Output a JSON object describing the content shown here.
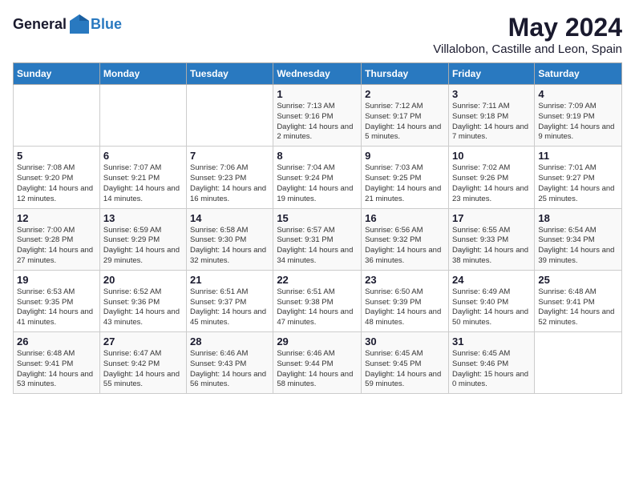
{
  "header": {
    "logo_general": "General",
    "logo_blue": "Blue",
    "month_year": "May 2024",
    "location": "Villalobon, Castille and Leon, Spain"
  },
  "calendar": {
    "weekdays": [
      "Sunday",
      "Monday",
      "Tuesday",
      "Wednesday",
      "Thursday",
      "Friday",
      "Saturday"
    ],
    "weeks": [
      [
        {
          "day": "",
          "info": ""
        },
        {
          "day": "",
          "info": ""
        },
        {
          "day": "",
          "info": ""
        },
        {
          "day": "1",
          "info": "Sunrise: 7:13 AM\nSunset: 9:16 PM\nDaylight: 14 hours\nand 2 minutes."
        },
        {
          "day": "2",
          "info": "Sunrise: 7:12 AM\nSunset: 9:17 PM\nDaylight: 14 hours\nand 5 minutes."
        },
        {
          "day": "3",
          "info": "Sunrise: 7:11 AM\nSunset: 9:18 PM\nDaylight: 14 hours\nand 7 minutes."
        },
        {
          "day": "4",
          "info": "Sunrise: 7:09 AM\nSunset: 9:19 PM\nDaylight: 14 hours\nand 9 minutes."
        }
      ],
      [
        {
          "day": "5",
          "info": "Sunrise: 7:08 AM\nSunset: 9:20 PM\nDaylight: 14 hours\nand 12 minutes."
        },
        {
          "day": "6",
          "info": "Sunrise: 7:07 AM\nSunset: 9:21 PM\nDaylight: 14 hours\nand 14 minutes."
        },
        {
          "day": "7",
          "info": "Sunrise: 7:06 AM\nSunset: 9:23 PM\nDaylight: 14 hours\nand 16 minutes."
        },
        {
          "day": "8",
          "info": "Sunrise: 7:04 AM\nSunset: 9:24 PM\nDaylight: 14 hours\nand 19 minutes."
        },
        {
          "day": "9",
          "info": "Sunrise: 7:03 AM\nSunset: 9:25 PM\nDaylight: 14 hours\nand 21 minutes."
        },
        {
          "day": "10",
          "info": "Sunrise: 7:02 AM\nSunset: 9:26 PM\nDaylight: 14 hours\nand 23 minutes."
        },
        {
          "day": "11",
          "info": "Sunrise: 7:01 AM\nSunset: 9:27 PM\nDaylight: 14 hours\nand 25 minutes."
        }
      ],
      [
        {
          "day": "12",
          "info": "Sunrise: 7:00 AM\nSunset: 9:28 PM\nDaylight: 14 hours\nand 27 minutes."
        },
        {
          "day": "13",
          "info": "Sunrise: 6:59 AM\nSunset: 9:29 PM\nDaylight: 14 hours\nand 29 minutes."
        },
        {
          "day": "14",
          "info": "Sunrise: 6:58 AM\nSunset: 9:30 PM\nDaylight: 14 hours\nand 32 minutes."
        },
        {
          "day": "15",
          "info": "Sunrise: 6:57 AM\nSunset: 9:31 PM\nDaylight: 14 hours\nand 34 minutes."
        },
        {
          "day": "16",
          "info": "Sunrise: 6:56 AM\nSunset: 9:32 PM\nDaylight: 14 hours\nand 36 minutes."
        },
        {
          "day": "17",
          "info": "Sunrise: 6:55 AM\nSunset: 9:33 PM\nDaylight: 14 hours\nand 38 minutes."
        },
        {
          "day": "18",
          "info": "Sunrise: 6:54 AM\nSunset: 9:34 PM\nDaylight: 14 hours\nand 39 minutes."
        }
      ],
      [
        {
          "day": "19",
          "info": "Sunrise: 6:53 AM\nSunset: 9:35 PM\nDaylight: 14 hours\nand 41 minutes."
        },
        {
          "day": "20",
          "info": "Sunrise: 6:52 AM\nSunset: 9:36 PM\nDaylight: 14 hours\nand 43 minutes."
        },
        {
          "day": "21",
          "info": "Sunrise: 6:51 AM\nSunset: 9:37 PM\nDaylight: 14 hours\nand 45 minutes."
        },
        {
          "day": "22",
          "info": "Sunrise: 6:51 AM\nSunset: 9:38 PM\nDaylight: 14 hours\nand 47 minutes."
        },
        {
          "day": "23",
          "info": "Sunrise: 6:50 AM\nSunset: 9:39 PM\nDaylight: 14 hours\nand 48 minutes."
        },
        {
          "day": "24",
          "info": "Sunrise: 6:49 AM\nSunset: 9:40 PM\nDaylight: 14 hours\nand 50 minutes."
        },
        {
          "day": "25",
          "info": "Sunrise: 6:48 AM\nSunset: 9:41 PM\nDaylight: 14 hours\nand 52 minutes."
        }
      ],
      [
        {
          "day": "26",
          "info": "Sunrise: 6:48 AM\nSunset: 9:41 PM\nDaylight: 14 hours\nand 53 minutes."
        },
        {
          "day": "27",
          "info": "Sunrise: 6:47 AM\nSunset: 9:42 PM\nDaylight: 14 hours\nand 55 minutes."
        },
        {
          "day": "28",
          "info": "Sunrise: 6:46 AM\nSunset: 9:43 PM\nDaylight: 14 hours\nand 56 minutes."
        },
        {
          "day": "29",
          "info": "Sunrise: 6:46 AM\nSunset: 9:44 PM\nDaylight: 14 hours\nand 58 minutes."
        },
        {
          "day": "30",
          "info": "Sunrise: 6:45 AM\nSunset: 9:45 PM\nDaylight: 14 hours\nand 59 minutes."
        },
        {
          "day": "31",
          "info": "Sunrise: 6:45 AM\nSunset: 9:46 PM\nDaylight: 15 hours\nand 0 minutes."
        },
        {
          "day": "",
          "info": ""
        }
      ]
    ]
  }
}
